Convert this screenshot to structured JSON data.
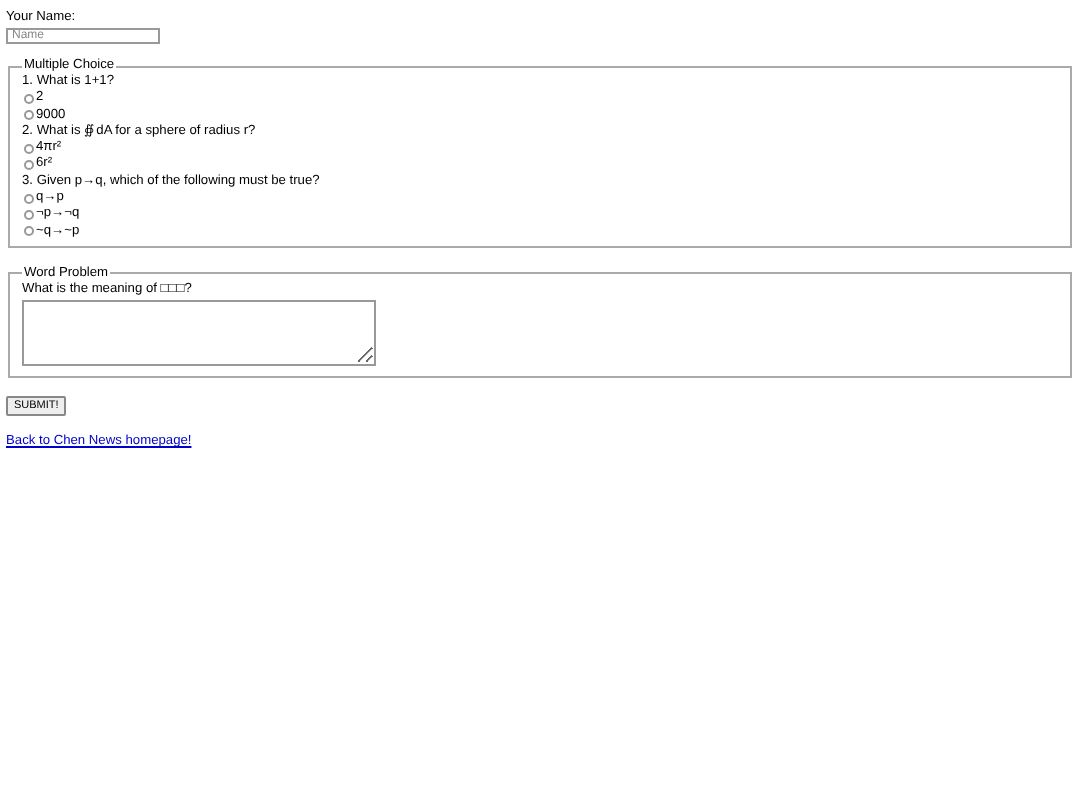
{
  "name_field": {
    "label": "Your Name:",
    "placeholder": "Name"
  },
  "multiple_choice": {
    "legend": "Multiple Choice",
    "questions": [
      {
        "text": "1. What is 1+1?",
        "options": [
          {
            "label": "2",
            "selected": false
          },
          {
            "label": "9000",
            "selected": false
          }
        ]
      },
      {
        "text": "2. What is ∯dA for a sphere of radius r?",
        "options": [
          {
            "label": "4πr²",
            "selected": false
          },
          {
            "label": "6r²",
            "selected": false
          }
        ]
      },
      {
        "text": "3. Given p→q, which of the following must be true?",
        "options": [
          {
            "label": "q→p",
            "selected": false
          },
          {
            "label": "¬p→¬q",
            "selected": false
          },
          {
            "label": "~q→~p",
            "selected": false
          }
        ]
      }
    ]
  },
  "word_problem": {
    "legend": "Word Problem",
    "question": "What is the meaning of □□□?"
  },
  "submit_button": "SUBMIT!",
  "back_link": "Back to Chen News homepage!"
}
